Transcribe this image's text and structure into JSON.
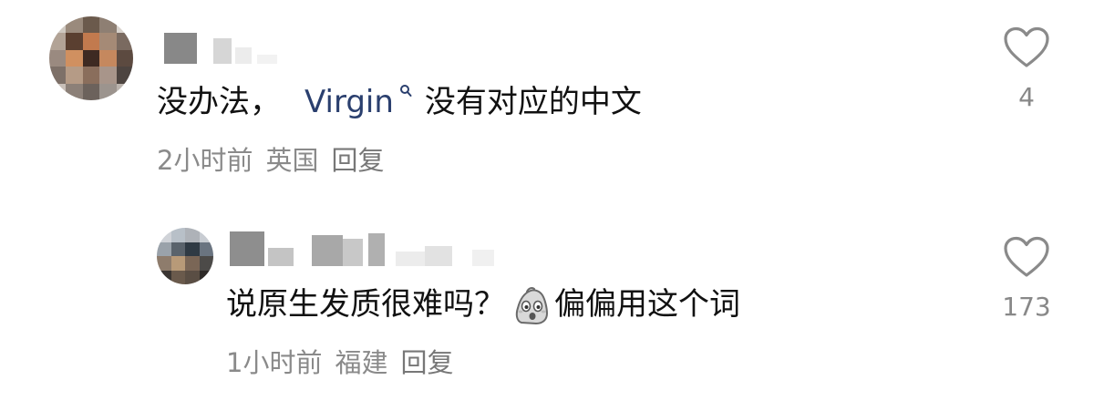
{
  "comments": [
    {
      "text_before": "没办法，",
      "link_text": "Virgin",
      "text_after": "没有对应的中文",
      "time": "2小时前",
      "location": "英国",
      "reply_label": "回复",
      "likes": "4",
      "link_icon": "search-icon"
    },
    {
      "text_before": "说原生发质很难吗？",
      "emoji": "emoji-face-icon",
      "text_after": "偏偏用这个词",
      "time": "1小时前",
      "location": "福建",
      "reply_label": "回复",
      "likes": "173"
    }
  ],
  "colors": {
    "link": "#2a3f6e",
    "meta": "#8a8a8a",
    "text": "#111111"
  }
}
